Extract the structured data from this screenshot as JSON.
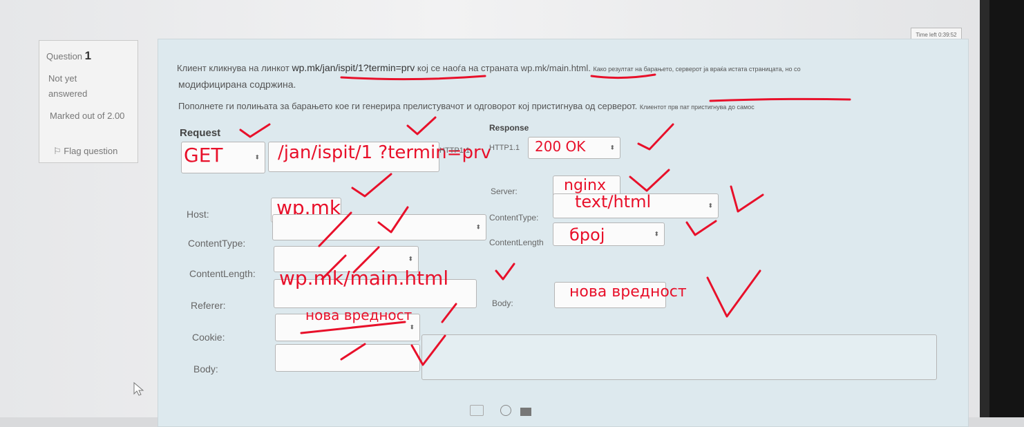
{
  "timer": {
    "text": "Time left 0:39:52"
  },
  "info": {
    "question_label": "Question",
    "question_number": "1",
    "status": "Not yet answered",
    "marks": "Marked out of 2.00",
    "flag": "Flag question"
  },
  "question": {
    "line1_prefix": "Клиент кликнува на линкот",
    "line1_link": "wp.mk/jan/ispit/1?termin=prv",
    "line1_mid": "кој се наоѓа на страната",
    "line1_page": "wp.mk/main.html.",
    "line1_suffix": "Како резултат на барањето, серверот ја враќа истата страницата, но со",
    "line2": "модифицирана содржина.",
    "line3": "Пополнете ги полињата за барањето кое ги генерира прелистувачот и одговорот кој пристигнува од серверот.",
    "line3_suffix": "Клиентот прв пат пристигнува до самос"
  },
  "request": {
    "title": "Request",
    "method": "GET",
    "url": "/jan/ispit/1 ?termin=prv",
    "protocol": "HTTP1.1",
    "host_label": "Host:",
    "host_value": "wp.mk",
    "content_type_label": "ContentType:",
    "content_length_label": "ContentLength:",
    "referer_label": "Referer:",
    "referer_value": "wp.mk/main.html",
    "cookie_label": "Cookie:",
    "cookie_value": "нова вредност",
    "body_label": "Body:"
  },
  "response": {
    "title": "Response",
    "protocol": "HTTP1.1",
    "status": "200 OK",
    "server_label": "Server:",
    "server_value": "nginx",
    "content_type_label": "ContentType:",
    "content_type_value": "text/html",
    "content_length_label": "ContentLength",
    "content_length_value": "број",
    "body_label": "Body:",
    "body_value": "нова вредност"
  },
  "colors": {
    "ink": "#e8102a",
    "panel": "#dde9ee"
  }
}
